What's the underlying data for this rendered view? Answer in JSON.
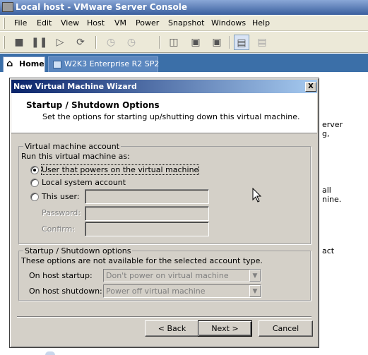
{
  "window": {
    "title": "Local host - VMware Server Console"
  },
  "menu": [
    "File",
    "Edit",
    "View",
    "Host",
    "VM",
    "Power",
    "Snapshot",
    "Windows",
    "Help"
  ],
  "toolbar": {
    "icons": [
      "stop-icon",
      "pause-icon",
      "play-icon",
      "reset-icon",
      "snapshot-icon",
      "revert-icon",
      "console-view-icon",
      "fullscreen-icon",
      "quick-switch-icon",
      "summary-icon",
      "appliance-icon"
    ]
  },
  "tabs": {
    "home": "Home",
    "vm": "W2K3 Enterprise R2 SP2"
  },
  "background_fragments": [
    "erver",
    "g,",
    "all",
    "nine.",
    "act"
  ],
  "dialog": {
    "title": "New Virtual Machine Wizard",
    "close": "X",
    "header_title": "Startup / Shutdown Options",
    "header_subtitle": "Set the options for starting up/shutting down this virtual machine.",
    "account_group": {
      "legend": "Virtual machine account",
      "run_as_label": "Run this virtual machine as:",
      "options": [
        "User that powers on the virtual machine",
        "Local system account",
        "This user:"
      ],
      "selected_index": 0,
      "user_value": "",
      "password_label": "Password:",
      "password_value": "",
      "confirm_label": "Confirm:",
      "confirm_value": ""
    },
    "startup_group": {
      "legend": "Startup / Shutdown options",
      "note": "These options are not available for the selected account type.",
      "startup_label": "On host startup:",
      "startup_value": "Don't power on virtual machine",
      "shutdown_label": "On host shutdown:",
      "shutdown_value": "Power off virtual machine"
    },
    "buttons": {
      "back": "< Back",
      "next": "Next >",
      "cancel": "Cancel"
    }
  }
}
